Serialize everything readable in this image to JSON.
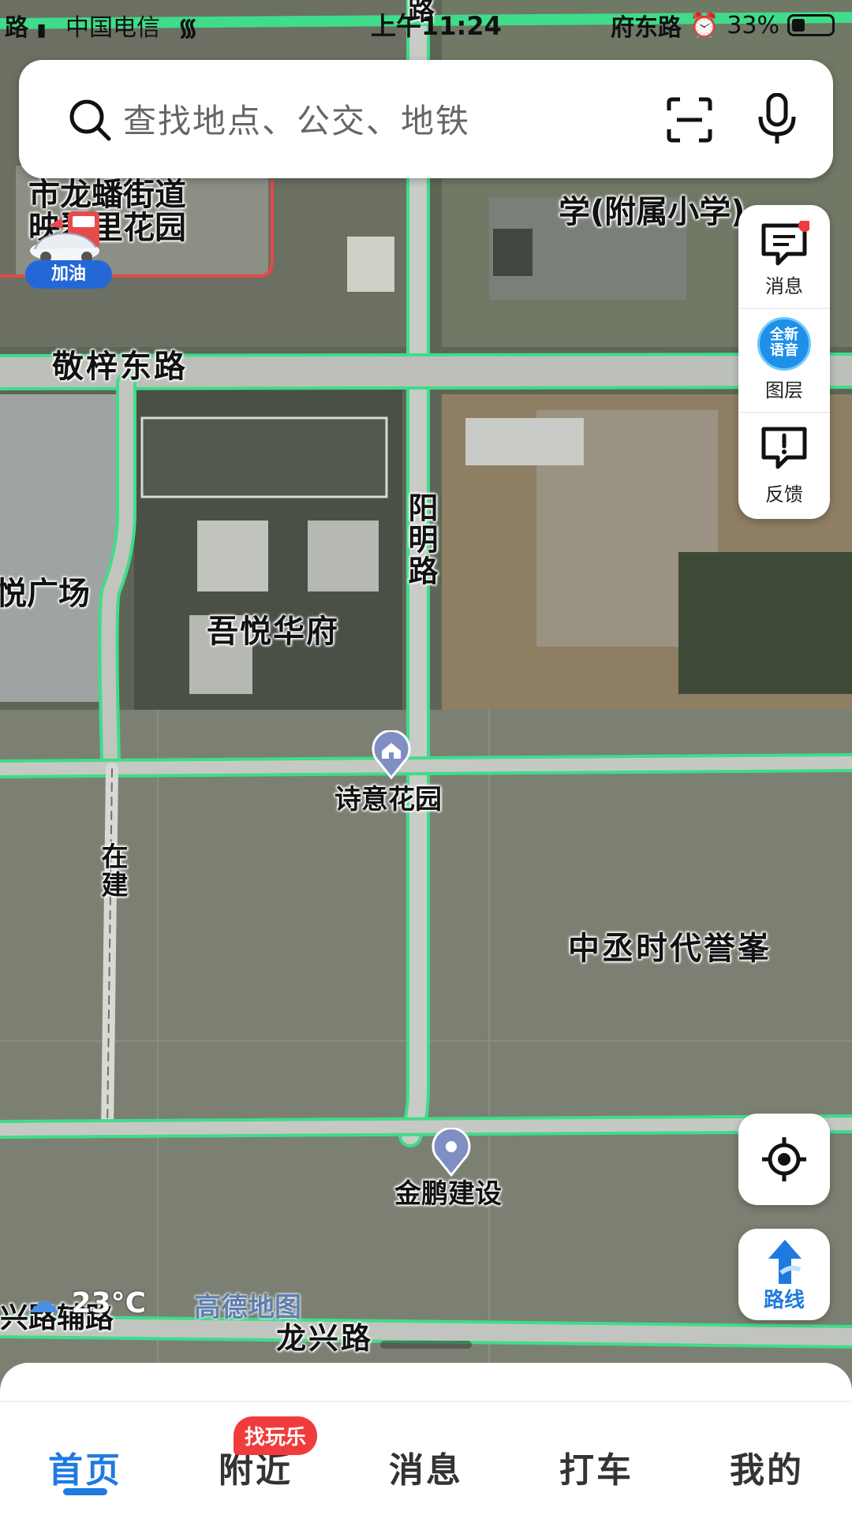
{
  "status_bar": {
    "left_fragment": "路",
    "carrier": "中国电信",
    "time": "上午11:24",
    "road_fragment": "府东路",
    "battery": "33%"
  },
  "search": {
    "placeholder": "查找地点、公交、地铁"
  },
  "gas_station": {
    "label": "加油"
  },
  "side_panel": {
    "message_label": "消息",
    "layer_badge": "全新语音",
    "layer_label": "图层",
    "feedback_label": "反馈"
  },
  "route_button": {
    "label": "路线"
  },
  "map_labels": {
    "top_road": "路",
    "district": "市龙蟠街道",
    "garden": "映翠里花园",
    "school": "学(附属小学)",
    "jingzi_road": "敬梓东路",
    "yangming_road": "阳明路",
    "plaza": "悦广场",
    "wuyue": "吾悦华府",
    "shiyi": "诗意花园",
    "under_construction": "在建",
    "zhongcheng": "中丞时代誉峯",
    "jinpeng": "金鹏建设",
    "xingfu_road": "兴路辅路",
    "longxing_road": "龙兴路"
  },
  "weather": {
    "temp": "23°C"
  },
  "brand": "高德地图",
  "bottom_nav": {
    "tabs": [
      "首页",
      "附近",
      "消息",
      "打车",
      "我的"
    ],
    "active_tab": "首页",
    "nearby_badge": "找玩乐"
  },
  "colors": {
    "accent": "#1f7ae0",
    "badge_red": "#f03c3c",
    "road_outline": "#3fdc8a",
    "map_gray": "#7c8072"
  }
}
